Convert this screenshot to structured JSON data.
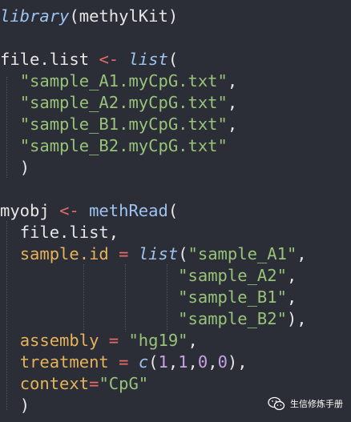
{
  "code": {
    "l1_fn": "library",
    "l1_rest": "(methylKit)",
    "l3_var": "file.list",
    "l3_op": "<-",
    "l3_fn": "list",
    "l3_paren": "(",
    "l4_str": "\"sample_A1.myCpG.txt\"",
    "l5_str": "\"sample_A2.myCpG.txt\"",
    "l6_str": "\"sample_B1.myCpG.txt\"",
    "l7_str": "\"sample_B2.myCpG.txt\"",
    "comma": ",",
    "close_paren": ")",
    "l10_var": "myobj",
    "l10_op": "<-",
    "l10_fn": "methRead",
    "l10_paren": "(",
    "l11_arg": "file.list,",
    "l12_param": "sample.id",
    "eq": "=",
    "l12_fn": "list",
    "l12_paren": "(",
    "l12_str": "\"sample_A1\"",
    "l13_str": "\"sample_A2\"",
    "l14_str": "\"sample_B1\"",
    "l15_str": "\"sample_B2\"",
    "l15_end": "),",
    "l16_param": "assembly",
    "l16_str": "\"hg19\"",
    "l17_param": "treatment",
    "l17_fn": "c",
    "l17_open": "(",
    "l17_nums": [
      "1",
      "1",
      "0",
      "0"
    ],
    "l17_end": "),",
    "l18_param": "context",
    "l18_str": "\"CpG\"",
    "l19_close": ")"
  },
  "watermark": {
    "text": "生信修炼手册",
    "icon": "wechat-icon"
  },
  "colors": {
    "background": "#2b2e36",
    "function": "#9ec3f0",
    "string": "#98c379",
    "operator": "#e66a6a",
    "argument": "#e6b35b",
    "number": "#c7a2e6",
    "plain": "#e6e6e6"
  }
}
